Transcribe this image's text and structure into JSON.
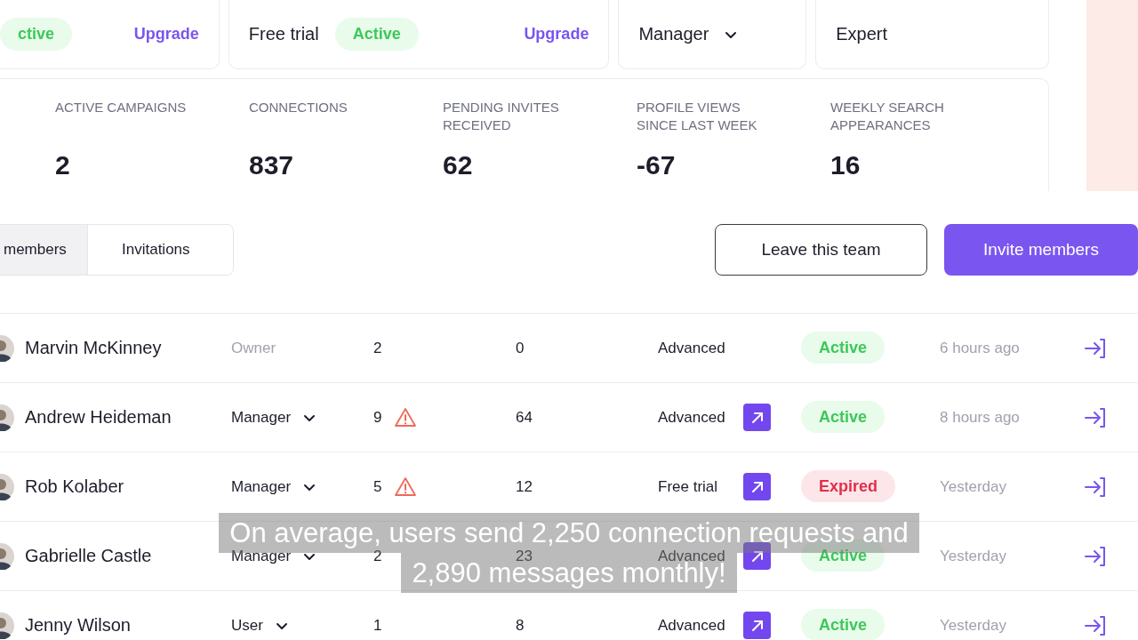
{
  "plan_cards": [
    {
      "kind": "status",
      "badge": "ctive",
      "link": "Upgrade"
    },
    {
      "kind": "status",
      "label": "Free trial",
      "badge": "Active",
      "link": "Upgrade"
    },
    {
      "kind": "dropdown",
      "label": "Manager"
    },
    {
      "kind": "plain",
      "label": "Expert"
    }
  ],
  "stats": [
    {
      "label": "ACTIVE CAMPAIGNS",
      "value": "2"
    },
    {
      "label": "CONNECTIONS",
      "value": "837"
    },
    {
      "label": "PENDING INVITES RECEIVED",
      "value": "62"
    },
    {
      "label": "PROFILE VIEWS SINCE LAST WEEK",
      "value": "-67"
    },
    {
      "label": "WEEKLY SEARCH APPEARANCES",
      "value": "16"
    }
  ],
  "tabs": [
    {
      "label": "members",
      "selected": true
    },
    {
      "label": "Invitations",
      "selected": false
    }
  ],
  "buttons": [
    {
      "label": "Leave this team",
      "kind": "outline"
    },
    {
      "label": "Invite members",
      "kind": "primary"
    }
  ],
  "members": [
    {
      "name": "Marvin McKinney",
      "role": {
        "text": "Owner",
        "kind": "fixed"
      },
      "campaigns": "2",
      "warning": false,
      "connections": "0",
      "plan": "Advanced",
      "upgrade_link": false,
      "status": {
        "text": "Active",
        "kind": "active"
      },
      "last_seen": "6 hours ago"
    },
    {
      "name": "Andrew Heideman",
      "role": {
        "text": "Manager",
        "kind": "dropdown"
      },
      "campaigns": "9",
      "warning": true,
      "connections": "64",
      "plan": "Advanced",
      "upgrade_link": true,
      "status": {
        "text": "Active",
        "kind": "active"
      },
      "last_seen": "8 hours ago"
    },
    {
      "name": "Rob Kolaber",
      "role": {
        "text": "Manager",
        "kind": "dropdown"
      },
      "campaigns": "5",
      "warning": true,
      "connections": "12",
      "plan": "Free trial",
      "upgrade_link": true,
      "status": {
        "text": "Expired",
        "kind": "expired"
      },
      "last_seen": "Yesterday"
    },
    {
      "name": "Gabrielle Castle",
      "role": {
        "text": "Manager",
        "kind": "dropdown"
      },
      "campaigns": "2",
      "warning": false,
      "connections": "23",
      "plan": "Advanced",
      "upgrade_link": true,
      "status": {
        "text": "Active",
        "kind": "active"
      },
      "last_seen": "Yesterday"
    },
    {
      "name": "Jenny Wilson",
      "role": {
        "text": "User",
        "kind": "dropdown"
      },
      "campaigns": "1",
      "warning": false,
      "connections": "8",
      "plan": "Advanced",
      "upgrade_link": true,
      "status": {
        "text": "Active",
        "kind": "active"
      },
      "last_seen": "Yesterday"
    }
  ],
  "caption": {
    "lines": [
      "On average, users send 2,250 connection requests and",
      "2,890 messages monthly!"
    ]
  }
}
